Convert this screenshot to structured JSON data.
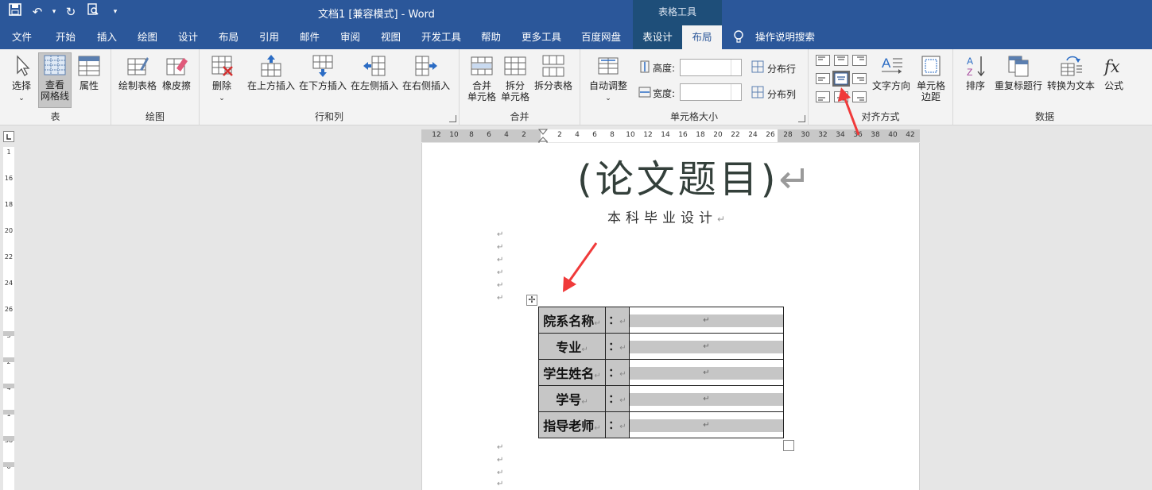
{
  "window": {
    "title": "文档1 [兼容模式]  -  Word",
    "context_group": "表格工具"
  },
  "tabs": [
    "文件",
    "开始",
    "插入",
    "绘图",
    "设计",
    "布局",
    "引用",
    "邮件",
    "审阅",
    "视图",
    "开发工具",
    "帮助",
    "更多工具",
    "百度网盘",
    "表设计",
    "布局"
  ],
  "tell_me": "操作说明搜索",
  "ribbon": {
    "table_group": {
      "label": "表",
      "select": "选择",
      "gridlines": "查看\n网格线",
      "properties": "属性"
    },
    "draw_group": {
      "label": "绘图",
      "draw_table": "绘制表格",
      "eraser": "橡皮擦"
    },
    "rows_cols_group": {
      "label": "行和列",
      "delete": "删除",
      "insert_above": "在上方插入",
      "insert_below": "在下方插入",
      "insert_left": "在左侧插入",
      "insert_right": "在右侧插入"
    },
    "merge_group": {
      "label": "合并",
      "merge_cells": "合并\n单元格",
      "split_cells": "拆分\n单元格",
      "split_table": "拆分表格"
    },
    "cell_size_group": {
      "label": "单元格大小",
      "autofit": "自动调整",
      "height_label": "高度:",
      "width_label": "宽度:",
      "dist_rows": "分布行",
      "dist_cols": "分布列"
    },
    "align_group": {
      "label": "对齐方式",
      "text_dir": "文字方向",
      "cell_margins": "单元格\n边距"
    },
    "data_group": {
      "label": "数据",
      "sort": "排序",
      "repeat_header": "重复标题行",
      "convert": "转换为文本",
      "formula": "公式"
    }
  },
  "ruler": {
    "left": [
      "12",
      "10",
      "8",
      "6",
      "4",
      "2"
    ],
    "mid": [
      "2",
      "4",
      "6",
      "8"
    ],
    "right": [
      "10",
      "12",
      "14",
      "16",
      "18",
      "20",
      "22",
      "24",
      "26",
      "28",
      "30",
      "32",
      "34",
      "36",
      "38",
      "40",
      "42"
    ],
    "vertical": [
      "1",
      "16",
      "18",
      "20",
      "22",
      "24",
      "26",
      "3",
      "2",
      "4",
      "1",
      "38",
      "0"
    ]
  },
  "document": {
    "title": "(论文题目)",
    "subtitle": "本科毕业设计",
    "return_mark": "↵",
    "form": [
      {
        "label": "院系名称",
        "colon": "："
      },
      {
        "label": "专业",
        "colon": "："
      },
      {
        "label": "学生姓名",
        "colon": "："
      },
      {
        "label": "学号",
        "colon": "："
      },
      {
        "label": "指导老师",
        "colon": "："
      }
    ]
  },
  "colors": {
    "brand": "#2b579a",
    "context_tab": "#1e4e79",
    "annotation_arrow": "#f03a3a",
    "cell_shade": "#c6c6c6"
  }
}
